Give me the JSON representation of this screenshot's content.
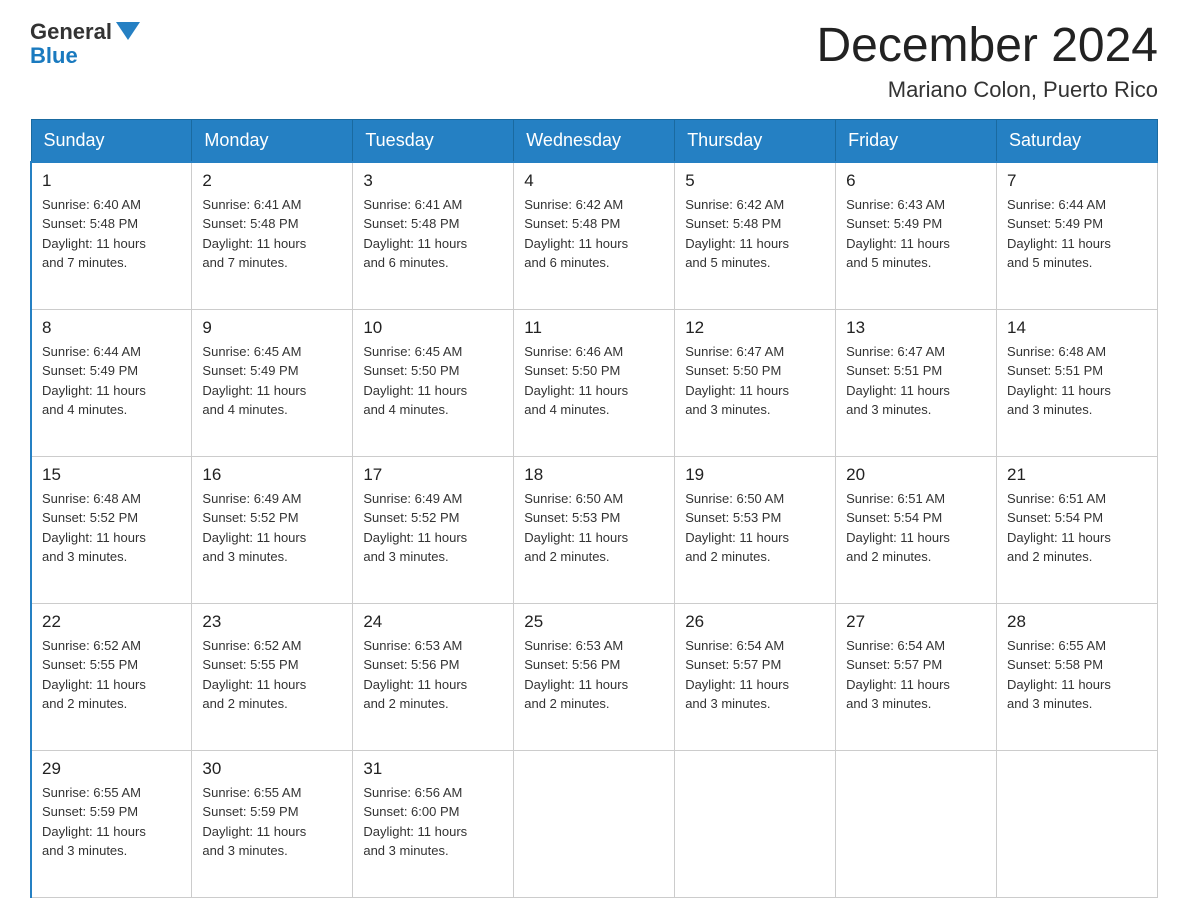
{
  "logo": {
    "general": "General",
    "blue": "Blue"
  },
  "title": {
    "month": "December 2024",
    "location": "Mariano Colon, Puerto Rico"
  },
  "weekdays": [
    "Sunday",
    "Monday",
    "Tuesday",
    "Wednesday",
    "Thursday",
    "Friday",
    "Saturday"
  ],
  "weeks": [
    [
      {
        "day": "1",
        "info": "Sunrise: 6:40 AM\nSunset: 5:48 PM\nDaylight: 11 hours\nand 7 minutes."
      },
      {
        "day": "2",
        "info": "Sunrise: 6:41 AM\nSunset: 5:48 PM\nDaylight: 11 hours\nand 7 minutes."
      },
      {
        "day": "3",
        "info": "Sunrise: 6:41 AM\nSunset: 5:48 PM\nDaylight: 11 hours\nand 6 minutes."
      },
      {
        "day": "4",
        "info": "Sunrise: 6:42 AM\nSunset: 5:48 PM\nDaylight: 11 hours\nand 6 minutes."
      },
      {
        "day": "5",
        "info": "Sunrise: 6:42 AM\nSunset: 5:48 PM\nDaylight: 11 hours\nand 5 minutes."
      },
      {
        "day": "6",
        "info": "Sunrise: 6:43 AM\nSunset: 5:49 PM\nDaylight: 11 hours\nand 5 minutes."
      },
      {
        "day": "7",
        "info": "Sunrise: 6:44 AM\nSunset: 5:49 PM\nDaylight: 11 hours\nand 5 minutes."
      }
    ],
    [
      {
        "day": "8",
        "info": "Sunrise: 6:44 AM\nSunset: 5:49 PM\nDaylight: 11 hours\nand 4 minutes."
      },
      {
        "day": "9",
        "info": "Sunrise: 6:45 AM\nSunset: 5:49 PM\nDaylight: 11 hours\nand 4 minutes."
      },
      {
        "day": "10",
        "info": "Sunrise: 6:45 AM\nSunset: 5:50 PM\nDaylight: 11 hours\nand 4 minutes."
      },
      {
        "day": "11",
        "info": "Sunrise: 6:46 AM\nSunset: 5:50 PM\nDaylight: 11 hours\nand 4 minutes."
      },
      {
        "day": "12",
        "info": "Sunrise: 6:47 AM\nSunset: 5:50 PM\nDaylight: 11 hours\nand 3 minutes."
      },
      {
        "day": "13",
        "info": "Sunrise: 6:47 AM\nSunset: 5:51 PM\nDaylight: 11 hours\nand 3 minutes."
      },
      {
        "day": "14",
        "info": "Sunrise: 6:48 AM\nSunset: 5:51 PM\nDaylight: 11 hours\nand 3 minutes."
      }
    ],
    [
      {
        "day": "15",
        "info": "Sunrise: 6:48 AM\nSunset: 5:52 PM\nDaylight: 11 hours\nand 3 minutes."
      },
      {
        "day": "16",
        "info": "Sunrise: 6:49 AM\nSunset: 5:52 PM\nDaylight: 11 hours\nand 3 minutes."
      },
      {
        "day": "17",
        "info": "Sunrise: 6:49 AM\nSunset: 5:52 PM\nDaylight: 11 hours\nand 3 minutes."
      },
      {
        "day": "18",
        "info": "Sunrise: 6:50 AM\nSunset: 5:53 PM\nDaylight: 11 hours\nand 2 minutes."
      },
      {
        "day": "19",
        "info": "Sunrise: 6:50 AM\nSunset: 5:53 PM\nDaylight: 11 hours\nand 2 minutes."
      },
      {
        "day": "20",
        "info": "Sunrise: 6:51 AM\nSunset: 5:54 PM\nDaylight: 11 hours\nand 2 minutes."
      },
      {
        "day": "21",
        "info": "Sunrise: 6:51 AM\nSunset: 5:54 PM\nDaylight: 11 hours\nand 2 minutes."
      }
    ],
    [
      {
        "day": "22",
        "info": "Sunrise: 6:52 AM\nSunset: 5:55 PM\nDaylight: 11 hours\nand 2 minutes."
      },
      {
        "day": "23",
        "info": "Sunrise: 6:52 AM\nSunset: 5:55 PM\nDaylight: 11 hours\nand 2 minutes."
      },
      {
        "day": "24",
        "info": "Sunrise: 6:53 AM\nSunset: 5:56 PM\nDaylight: 11 hours\nand 2 minutes."
      },
      {
        "day": "25",
        "info": "Sunrise: 6:53 AM\nSunset: 5:56 PM\nDaylight: 11 hours\nand 2 minutes."
      },
      {
        "day": "26",
        "info": "Sunrise: 6:54 AM\nSunset: 5:57 PM\nDaylight: 11 hours\nand 3 minutes."
      },
      {
        "day": "27",
        "info": "Sunrise: 6:54 AM\nSunset: 5:57 PM\nDaylight: 11 hours\nand 3 minutes."
      },
      {
        "day": "28",
        "info": "Sunrise: 6:55 AM\nSunset: 5:58 PM\nDaylight: 11 hours\nand 3 minutes."
      }
    ],
    [
      {
        "day": "29",
        "info": "Sunrise: 6:55 AM\nSunset: 5:59 PM\nDaylight: 11 hours\nand 3 minutes."
      },
      {
        "day": "30",
        "info": "Sunrise: 6:55 AM\nSunset: 5:59 PM\nDaylight: 11 hours\nand 3 minutes."
      },
      {
        "day": "31",
        "info": "Sunrise: 6:56 AM\nSunset: 6:00 PM\nDaylight: 11 hours\nand 3 minutes."
      },
      {
        "day": "",
        "info": ""
      },
      {
        "day": "",
        "info": ""
      },
      {
        "day": "",
        "info": ""
      },
      {
        "day": "",
        "info": ""
      }
    ]
  ]
}
